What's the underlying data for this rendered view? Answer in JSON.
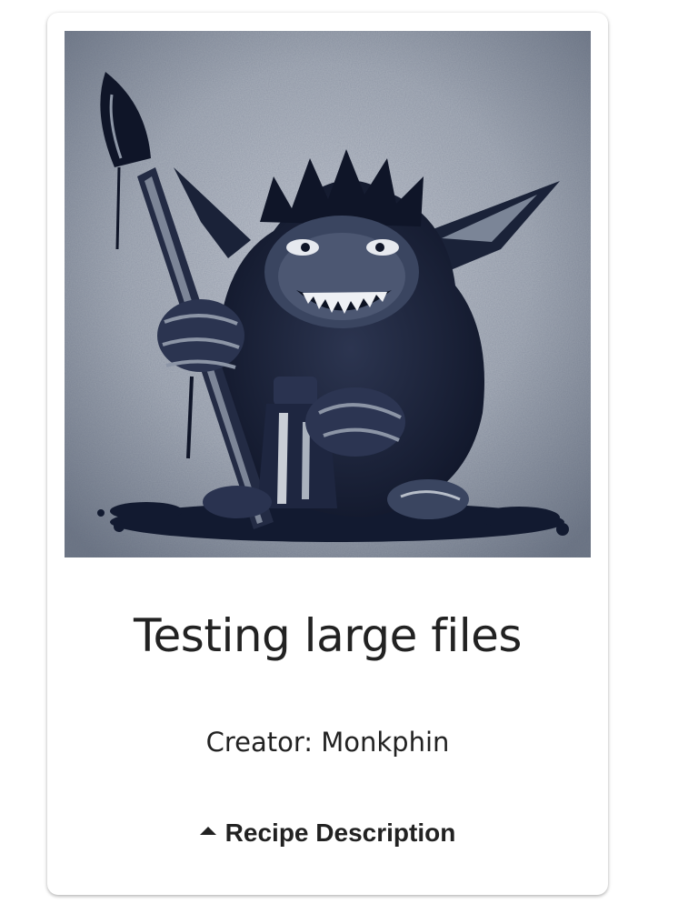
{
  "card": {
    "image_alt": "Goblin holding a paint brush and an ink bottle",
    "title": "Testing large files",
    "creator_text": "Creator: Monkphin",
    "description_toggle": {
      "label": "Recipe Description",
      "icon": "caret-up-icon",
      "expanded": false
    }
  },
  "colors": {
    "text": "#222222",
    "card_background": "#ffffff",
    "image_ink": "#141c34"
  }
}
